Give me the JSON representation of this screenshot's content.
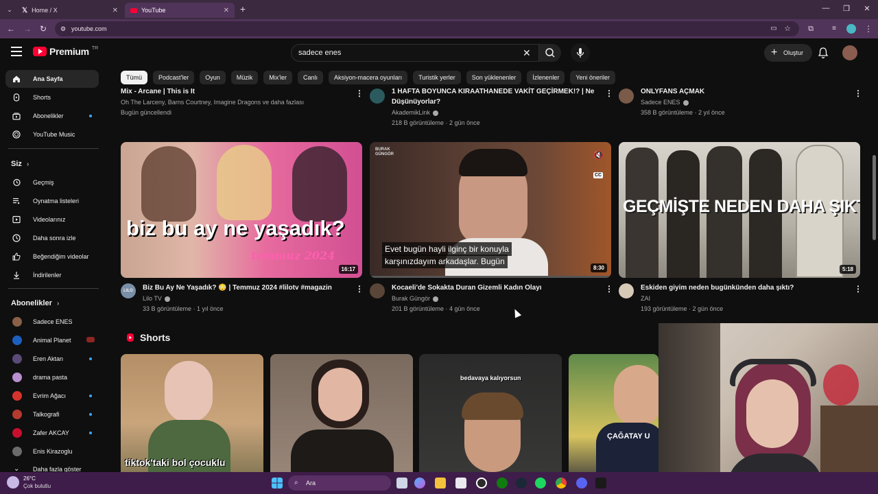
{
  "browser": {
    "tabs": [
      {
        "title": "Home / X",
        "active": false
      },
      {
        "title": "YouTube",
        "active": true
      }
    ],
    "url": "youtube.com",
    "new_tab": "+"
  },
  "youtube": {
    "logo_text": "Premium",
    "logo_country": "TR",
    "search_value": "sadece enes",
    "create_label": "Oluştur",
    "chips": [
      "Tümü",
      "Podcast'ler",
      "Oyun",
      "Müzik",
      "Mix'ler",
      "Canlı",
      "Aksiyon-macera oyunları",
      "Turistik yerler",
      "Son yüklenenler",
      "İzlenenler",
      "Yeni öneriler"
    ],
    "sidebar": {
      "main": [
        "Ana Sayfa",
        "Shorts",
        "Abonelikler",
        "YouTube Music"
      ],
      "you_head": "Siz",
      "you": [
        "Geçmiş",
        "Oynatma listeleri",
        "Videolarınız",
        "Daha sonra izle",
        "Beğendiğim videolar",
        "İndirilenler"
      ],
      "subs_head": "Abonelikler",
      "subs": [
        "Sadece ENES",
        "Animal Planet",
        "Eren Aktan",
        "drama pasta",
        "Evrim Ağacı",
        "Talkografi",
        "Zafer AKCAY",
        "Enis Kirazoglu"
      ],
      "show_more": "Daha fazla göster"
    },
    "row1": [
      {
        "title": "Mix - Arcane | This is It",
        "channel": "Oh The Larceny, Barns Courtney, Imagine Dragons ve daha fazlası",
        "meta": "Bugün güncellendi"
      },
      {
        "title1": "1 HAFTA BOYUNCA KIRAATHANEDE VAKİT GEÇİRMEK!? | Ne",
        "title2": "Düşünüyorlar?",
        "channel": "AkademikLink",
        "meta": "218 B görüntüleme · 2 gün önce"
      },
      {
        "title": "ONLYFANS AÇMAK",
        "channel": "Sadece ENES",
        "meta": "358 B görüntüleme · 2 yıl önce"
      }
    ],
    "row2": [
      {
        "title": "Biz Bu Ay Ne Yaşadık? 😳 | Temmuz 2024 #lilotv #magazin",
        "channel": "Lilo TV",
        "meta": "33 B görüntüleme · 1 yıl önce",
        "duration": "16:17",
        "thumb_text": "biz bu ay ne yaşadık?",
        "thumb_sub": "temmuz 2024",
        "avatar_text": "LILO"
      },
      {
        "title": "Kocaeli'de Sokakta Duran Gizemli Kadın Olayı",
        "channel": "Burak Güngör",
        "meta": "201 B görüntüleme · 4 gün önce",
        "duration": "8:30",
        "caption1": "Evet bugün hayli ilginç bir konuyla",
        "caption2": "karşınızdayım arkadaşlar. Bugün",
        "brand": "BURAK GÜNGÖR",
        "cc": "CC"
      },
      {
        "title": "Eskiden giyim neden bugünkünden daha şıktı?",
        "channel": "ZAI",
        "meta": "193 görüntüleme · 2 gün önce",
        "duration": "5:18",
        "thumb_text": "GEÇMİŞTE NEDEN DAHA ŞIKTIK ?"
      }
    ],
    "shorts_head": "Shorts",
    "shorts": [
      {
        "overlay": "tiktok'taki bol çocuklu"
      },
      {
        "overlay": ""
      },
      {
        "overlay": "bedavaya kalıyorsun"
      },
      {
        "overlay": "ÇAĞATAY U"
      }
    ]
  },
  "taskbar": {
    "weather_temp": "26°C",
    "weather_desc": "Çok bulutlu",
    "search_label": "Ara"
  },
  "colors": {
    "yt_bg": "#0f0f0f",
    "yt_red": "#ff0033",
    "chrome_purple": "#51345a",
    "taskbar": "#3f1d4a"
  }
}
